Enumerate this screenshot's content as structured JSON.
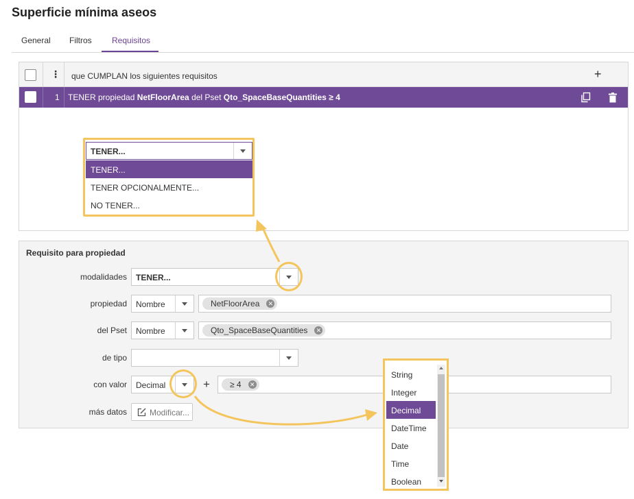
{
  "page": {
    "title": "Superficie mínima aseos"
  },
  "tabs": [
    {
      "label": "General"
    },
    {
      "label": "Filtros"
    },
    {
      "label": "Requisitos",
      "active": true
    }
  ],
  "requirements": {
    "header_text": "que CUMPLAN los siguientes requisitos",
    "add_symbol": "+",
    "menu_symbol": "⋮",
    "rows": [
      {
        "index": "1",
        "prefix": "TENER propiedad ",
        "property": "NetFloorArea",
        "middle": " del Pset ",
        "pset": "Qto_SpaceBaseQuantities ≥ 4"
      }
    ],
    "modality_dropdown": {
      "selected": "TENER...",
      "options": [
        "TENER...",
        "TENER OPCIONALMENTE...",
        "NO TENER..."
      ]
    }
  },
  "property_form": {
    "title": "Requisito para propiedad",
    "modalidades": {
      "label": "modalidades",
      "value": "TENER..."
    },
    "propiedad": {
      "label": "propiedad",
      "mode": "Nombre",
      "chip": "NetFloorArea"
    },
    "pset": {
      "label": "del Pset",
      "mode": "Nombre",
      "chip": "Qto_SpaceBaseQuantities"
    },
    "tipo": {
      "label": "de tipo",
      "value": ""
    },
    "valor": {
      "label": "con valor",
      "type": "Decimal",
      "add_symbol": "+",
      "chip": "≥ 4"
    },
    "mas_datos": {
      "label": "más datos",
      "button": "Modificar..."
    }
  },
  "type_dropdown": {
    "options": [
      "String",
      "Integer",
      "Decimal",
      "DateTime",
      "Date",
      "Time",
      "Boolean"
    ],
    "selected": "Decimal"
  },
  "colors": {
    "accent": "#6f4a96",
    "highlight": "#f4c55c"
  }
}
